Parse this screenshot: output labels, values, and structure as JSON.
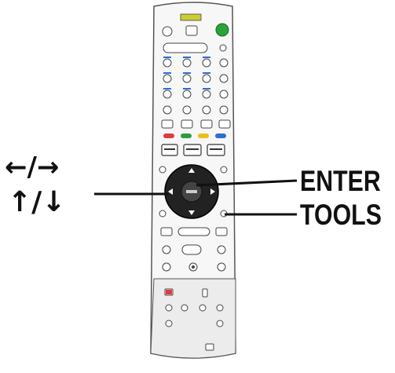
{
  "callouts": {
    "enter": "ENTER",
    "tools": "TOOLS",
    "left_right": "←/→",
    "up_down": "↑/↓"
  },
  "icons": {
    "left_right": "left-right-arrow-icon",
    "up_down": "up-down-arrow-icon"
  },
  "colors": {
    "power_button": "#2aa33a",
    "red_key": "#e23a3a",
    "green_key": "#2f9e3e",
    "yellow_key": "#e8c21a",
    "blue_key": "#2c6fd0",
    "dpad": "#222222"
  }
}
